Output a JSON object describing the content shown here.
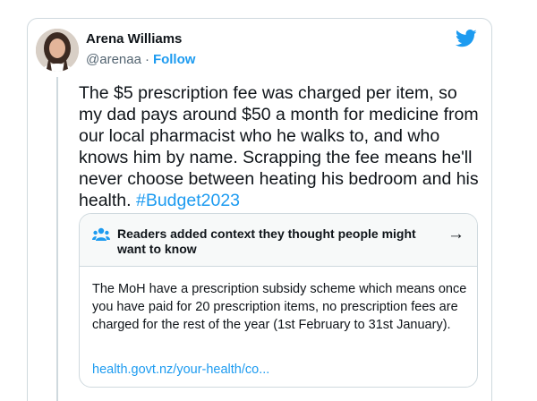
{
  "tweet": {
    "author_name": "Arena Williams",
    "handle": "@arenaa",
    "separator": "·",
    "follow_label": "Follow",
    "text": "The $5 prescription fee was charged per item, so my dad pays around $50 a month for medicine from our local pharmacist who he walks to, and who knows him by name. Scrapping the fee means he'll never choose between heating his bedroom and his health.",
    "hashtag": "#Budget2023"
  },
  "context_note": {
    "title": "Readers added context they thought people might want to know",
    "arrow": "→",
    "body": "The MoH have a prescription subsidy scheme which means once you have paid for 20 prescription items, no prescription fees are charged for the rest of the year (1st February to 31st January).",
    "link_text": "health.govt.nz/your-health/co..."
  },
  "icons": {
    "brand": "twitter-bird-icon",
    "context": "people-icon",
    "navigate": "arrow-right-icon"
  },
  "colors": {
    "link": "#1d9bf0",
    "text": "#0f1419",
    "secondary": "#536471",
    "border": "#cfd9de",
    "context_header_bg": "#f7f9f9"
  }
}
